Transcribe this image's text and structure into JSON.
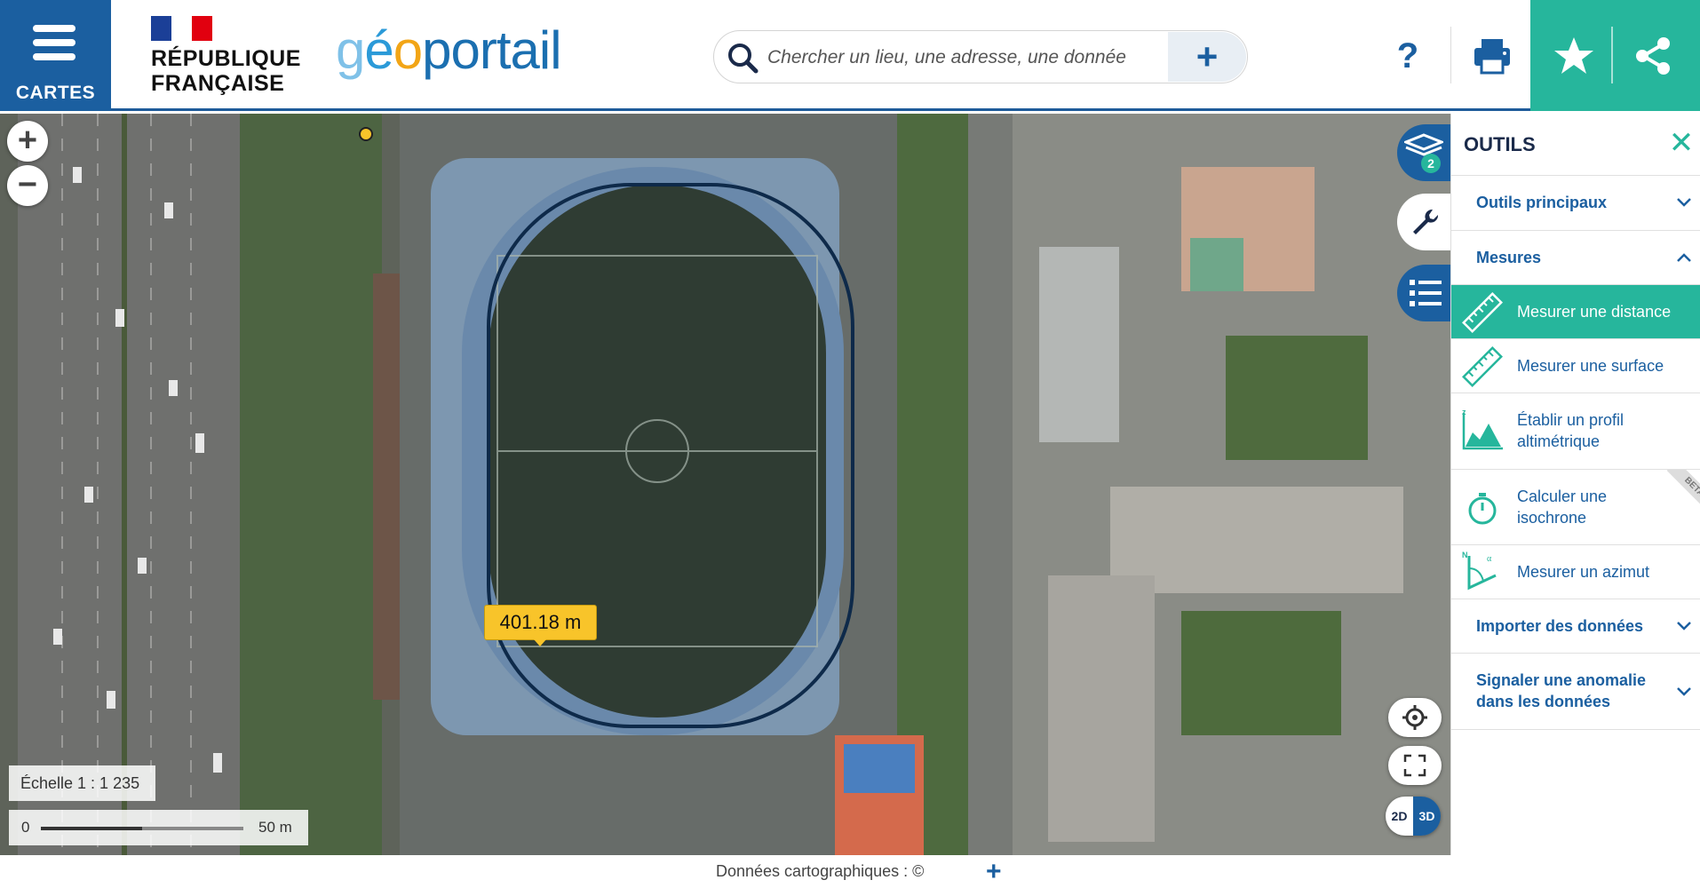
{
  "header": {
    "menu_label": "CARTES",
    "republic_line1": "RÉPUBLIQUE",
    "republic_line2": "FRANÇAISE",
    "logo": {
      "g": "g",
      "e": "é",
      "o": "o",
      "portail": "portail"
    },
    "search_placeholder": "Chercher un lieu, une adresse, une donnée",
    "search_plus": "+",
    "help_label": "?",
    "colors": {
      "primary": "#1b5fa0",
      "accent": "#26b69c"
    }
  },
  "map": {
    "zoom_in": "+",
    "zoom_out": "−",
    "measure_result": "401.18 m",
    "scale_text": "Échelle 1 : 1 235",
    "scale_zero": "0",
    "scale_max": "50 m",
    "layers_count": "2",
    "mode_2d": "2D",
    "mode_3d": "3D"
  },
  "panel": {
    "title": "OUTILS",
    "close": "✕",
    "sections": {
      "main_tools": "Outils principaux",
      "measures": "Mesures",
      "import": "Importer des données",
      "report": "Signaler une anomalie dans les données"
    },
    "items": [
      {
        "label": "Mesurer une distance",
        "icon": "ruler-icon",
        "active": true
      },
      {
        "label": "Mesurer une surface",
        "icon": "ruler-icon"
      },
      {
        "label": "Établir un profil altimétrique",
        "icon": "elevation-profile-icon"
      },
      {
        "label": "Calculer une isochrone",
        "icon": "stopwatch-icon",
        "badge": "BETA"
      },
      {
        "label": "Mesurer un azimut",
        "icon": "azimuth-icon"
      }
    ]
  },
  "footer": {
    "text": "Données cartographiques : ©",
    "plus": "+"
  }
}
